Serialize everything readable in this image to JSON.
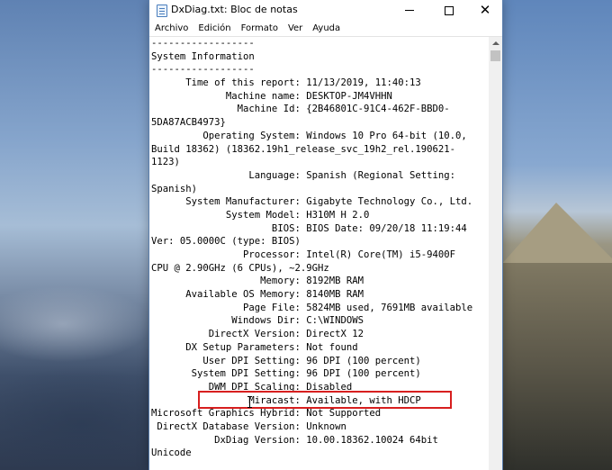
{
  "window": {
    "title": "DxDiag.txt: Bloc de notas",
    "controls": {
      "minimize_icon": "minimize-icon",
      "maximize_icon": "maximize-icon",
      "close_icon": "close-icon"
    }
  },
  "menu": [
    "Archivo",
    "Edición",
    "Formato",
    "Ver",
    "Ayuda"
  ],
  "editor": {
    "lines": [
      "------------------",
      "System Information",
      "------------------",
      "      Time of this report: 11/13/2019, 11:40:13",
      "             Machine name: DESKTOP-JM4VHHN",
      "               Machine Id: {2B46801C-91C4-462F-BBD0-",
      "5DA87ACB4973}",
      "         Operating System: Windows 10 Pro 64-bit (10.0,",
      "Build 18362) (18362.19h1_release_svc_19h2_rel.190621-",
      "1123)",
      "                 Language: Spanish (Regional Setting:",
      "Spanish)",
      "      System Manufacturer: Gigabyte Technology Co., Ltd.",
      "             System Model: H310M H 2.0",
      "                     BIOS: BIOS Date: 09/20/18 11:19:44",
      "Ver: 05.0000C (type: BIOS)",
      "                Processor: Intel(R) Core(TM) i5-9400F",
      "CPU @ 2.90GHz (6 CPUs), ~2.9GHz",
      "                   Memory: 8192MB RAM",
      "      Available OS Memory: 8140MB RAM",
      "                Page File: 5824MB used, 7691MB available",
      "              Windows Dir: C:\\WINDOWS",
      "          DirectX Version: DirectX 12",
      "      DX Setup Parameters: Not found",
      "         User DPI Setting: 96 DPI (100 percent)",
      "       System DPI Setting: 96 DPI (100 percent)",
      "          DWM DPI Scaling: Disabled",
      "                 Miracast: Available, with HDCP",
      "Microsoft Graphics Hybrid: Not Supported",
      " DirectX Database Version: Unknown",
      "           DxDiag Version: 10.00.18362.10024 64bit",
      "Unicode"
    ]
  },
  "annotation": {
    "highlight_color": "#d71f1f"
  }
}
